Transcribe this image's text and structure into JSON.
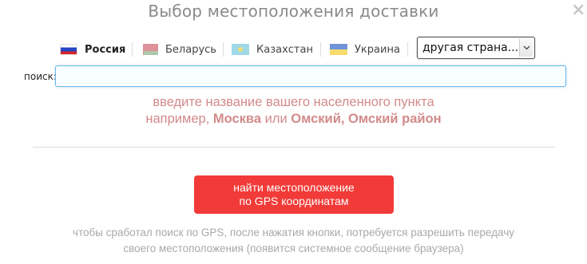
{
  "dialog": {
    "title": "Выбор местоположения доставки",
    "close_label": "×"
  },
  "countries": [
    {
      "name": "Россия",
      "flag": "russia-flag-icon",
      "active": true
    },
    {
      "name": "Беларусь",
      "flag": "belarus-flag-icon",
      "active": false
    },
    {
      "name": "Казахстан",
      "flag": "kazakhstan-flag-icon",
      "active": false
    },
    {
      "name": "Украина",
      "flag": "ukraine-flag-icon",
      "active": false
    }
  ],
  "other_country_select": {
    "value": "другая страна..."
  },
  "search": {
    "label": "поиск:",
    "value": "",
    "placeholder": ""
  },
  "hint": {
    "line1": "введите название вашего населенного пункта",
    "example_prefix": "например,",
    "example_1": "Москва",
    "or": "или",
    "example_2": "Омский, Омский район"
  },
  "gps": {
    "button_line1": "найти местоположение",
    "button_line2": "по GPS координатам",
    "note_line1": "чтобы сработал поиск по GPS, после нажатия кнопки, потребуется разрешить передачу",
    "note_line2": "своего местоположения (появится системное сообщение браузера)"
  },
  "colors": {
    "accent_button": "#f23b38",
    "hint_text": "#d38a8a",
    "input_border": "#6eb6e6",
    "title": "#8a8a8a"
  }
}
